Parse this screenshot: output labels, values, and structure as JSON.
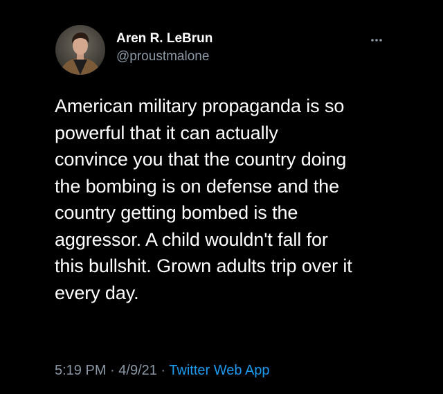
{
  "tweet": {
    "author": {
      "display_name": "Aren R. LeBrun",
      "handle": "@proustmalone"
    },
    "more_icon": "more-horizontal-icon",
    "text": "American military propaganda is so\npowerful that it can actually\nconvince you that the country doing\nthe bombing is on defense and the\ncountry getting bombed is the\naggressor. A child wouldn't fall for\nthis bullshit. Grown adults trip over it\nevery day.",
    "meta": {
      "time": "5:19 PM",
      "separator_1": " · ",
      "date": "4/9/21",
      "separator_2": " · ",
      "source": "Twitter Web App"
    }
  },
  "colors": {
    "background": "#000000",
    "text_primary": "#ffffff",
    "text_secondary": "#8b98a5",
    "link": "#1d9bf0"
  }
}
